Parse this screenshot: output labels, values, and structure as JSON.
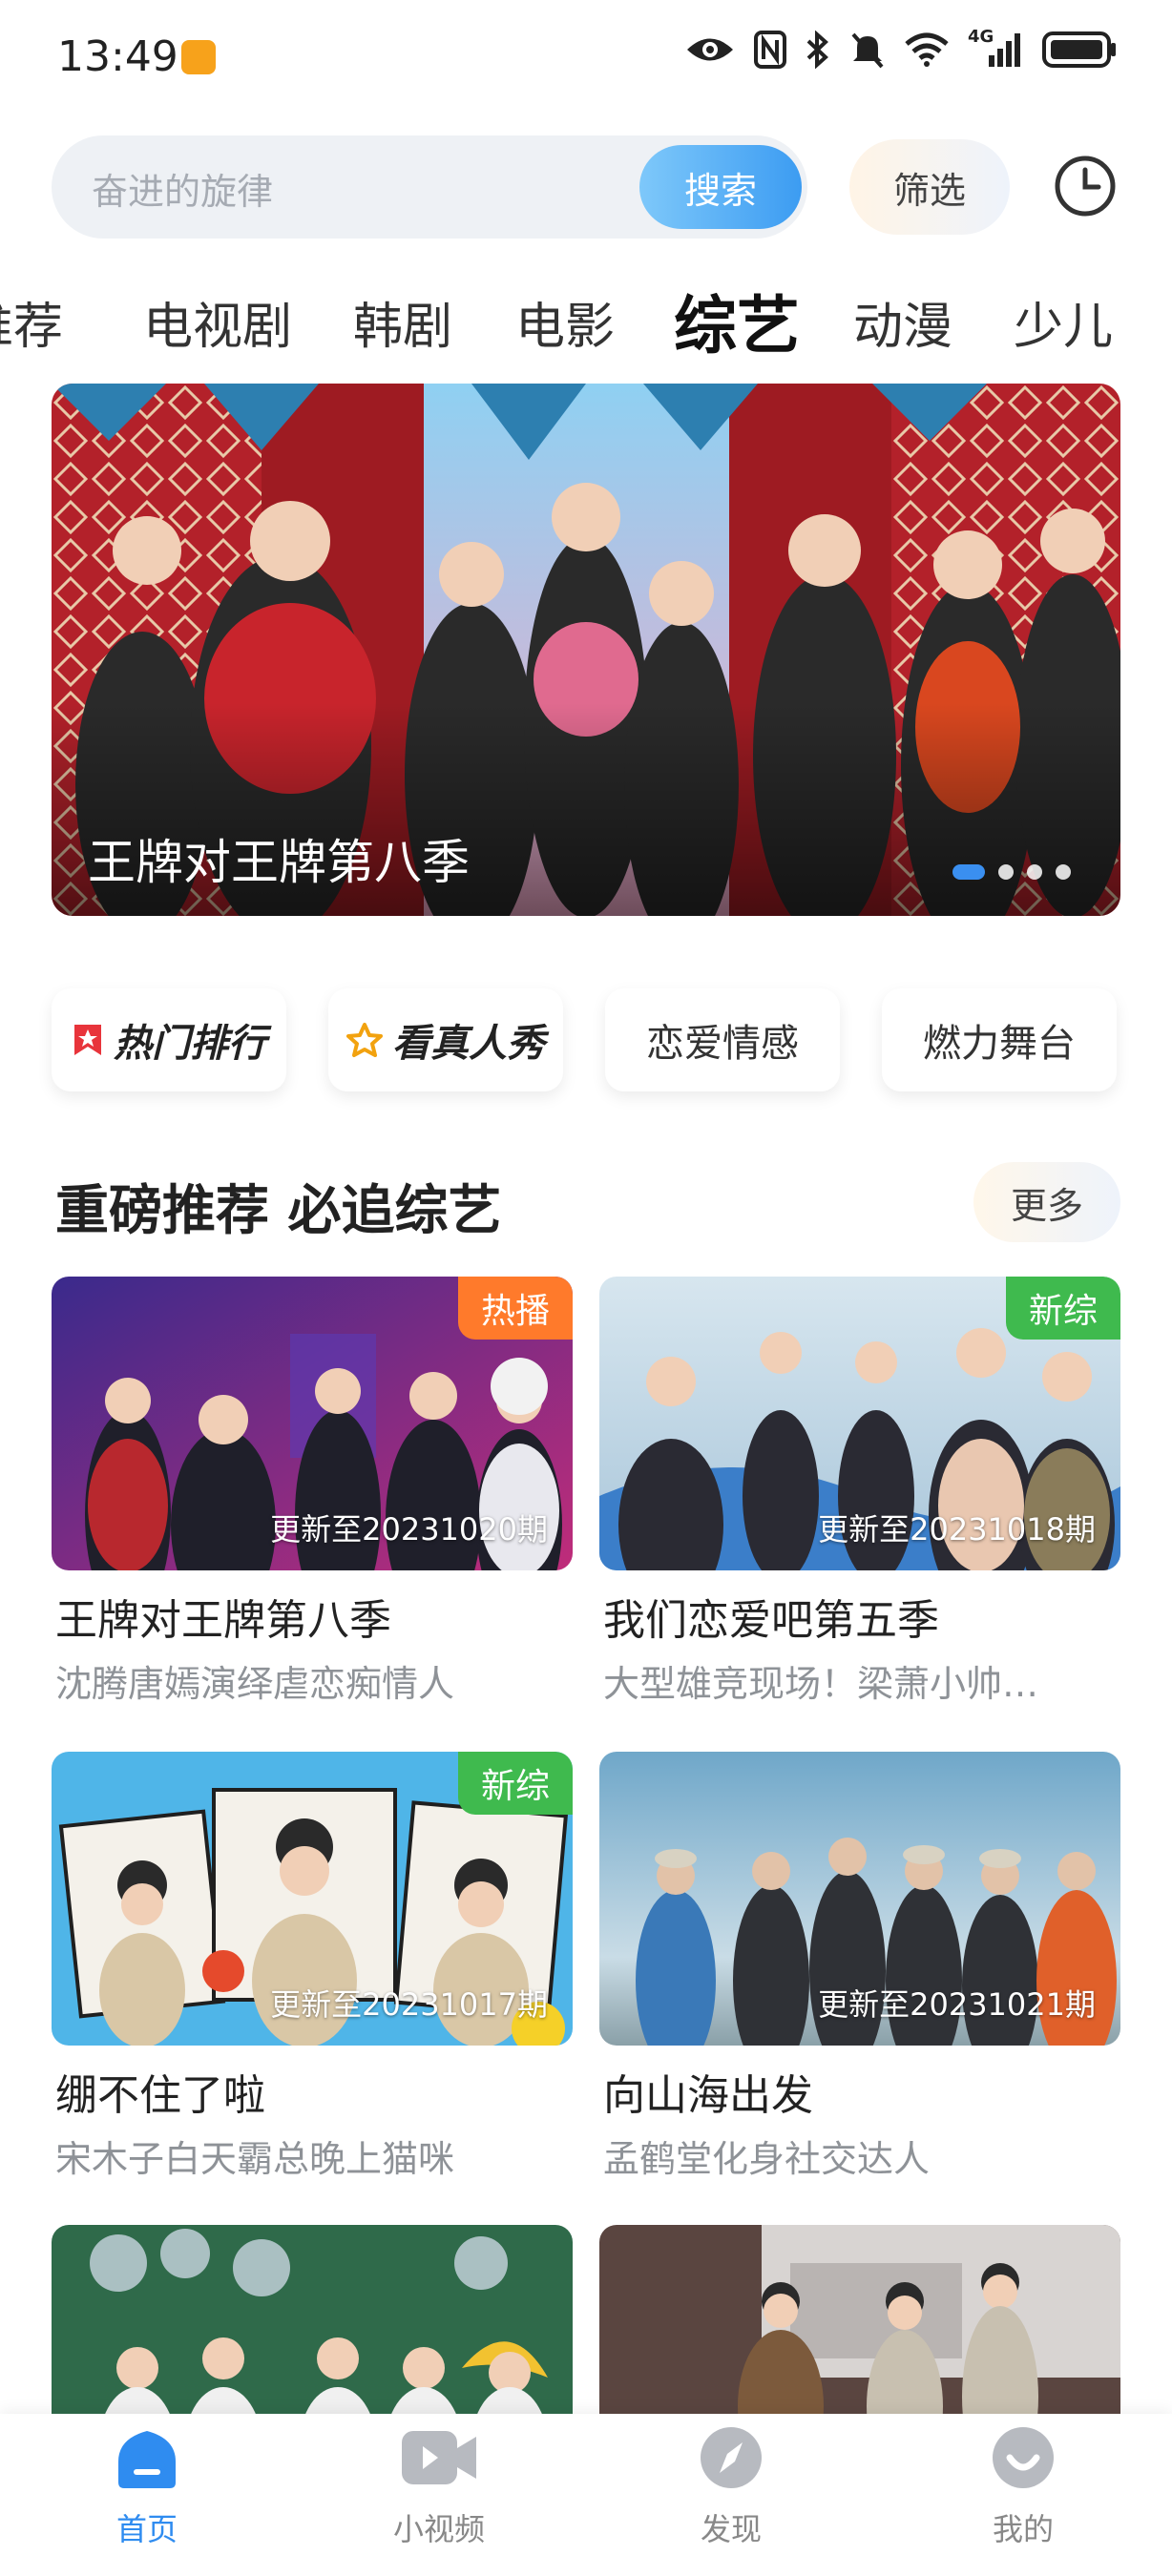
{
  "status_bar": {
    "time": "13:49",
    "network_label": "4G",
    "icons": [
      "eye-icon",
      "nfc-icon",
      "bluetooth-icon",
      "mute-icon",
      "wifi-icon",
      "signal-icon",
      "battery-icon"
    ]
  },
  "search": {
    "placeholder": "奋进的旋律",
    "button_label": "搜索",
    "filter_label": "筛选"
  },
  "categories": [
    "推荐",
    "电视剧",
    "韩剧",
    "电影",
    "综艺",
    "动漫",
    "少儿"
  ],
  "banner": {
    "title": "王牌对王牌第八季",
    "page_count": 4,
    "active_page": 1
  },
  "chips": [
    {
      "label": "热门排行",
      "icon": "bookmark-icon"
    },
    {
      "label": "看真人秀",
      "icon": "star-icon"
    },
    {
      "label": "恋爱情感"
    },
    {
      "label": "燃力舞台"
    }
  ],
  "section": {
    "title": "重磅推荐 必追综艺",
    "more_label": "更多"
  },
  "cards": [
    {
      "title": "王牌对王牌第八季",
      "subtitle": "沈腾唐嫣演绎虐恋痴情人",
      "update": "更新至20231020期",
      "tag": "热播"
    },
    {
      "title": "我们恋爱吧第五季",
      "subtitle": "大型雄竞现场！梁萧小帅…",
      "update": "更新至20231018期",
      "tag": "新综"
    },
    {
      "title": "绷不住了啦",
      "subtitle": "宋木子白天霸总晚上猫咪",
      "update": "更新至20231017期",
      "tag": "新综"
    },
    {
      "title": "向山海出发",
      "subtitle": "孟鹤堂化身社交达人",
      "update": "更新至20231021期",
      "tag": ""
    }
  ],
  "bottom_nav": [
    {
      "label": "首页",
      "icon": "home-icon",
      "active": true
    },
    {
      "label": "小视频",
      "icon": "video-icon",
      "active": false
    },
    {
      "label": "发现",
      "icon": "compass-icon",
      "active": false
    },
    {
      "label": "我的",
      "icon": "profile-icon",
      "active": false
    }
  ],
  "colors": {
    "accent": "#2f8cf0",
    "tag_hot": "#ff7a2b",
    "tag_new": "#3fba4e"
  }
}
